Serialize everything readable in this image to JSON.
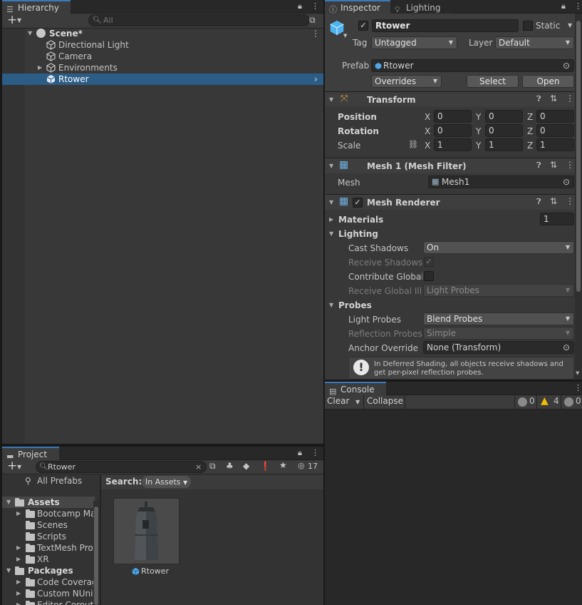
{
  "hierarchy": {
    "tab_label": "Hierarchy",
    "search_placeholder": "All",
    "add_label": "+",
    "scene_name": "Scene*",
    "items": [
      {
        "label": "Directional Light"
      },
      {
        "label": "Camera"
      },
      {
        "label": "Environments"
      },
      {
        "label": "Rtower"
      }
    ],
    "icons": {
      "tab": "list-icon",
      "lock": "lock-icon",
      "more": "kebab-icon",
      "gameobject": "cube-icon"
    }
  },
  "inspector": {
    "tab_label": "Inspector",
    "lighting_tab_label": "Lighting",
    "object_name": "Rtower",
    "static_label": "Static",
    "tag_label": "Tag",
    "tag_value": "Untagged",
    "layer_label": "Layer",
    "layer_value": "Default",
    "prefab_label": "Prefab",
    "prefab_value": "Rtower",
    "overrides_label": "Overrides",
    "select_label": "Select",
    "open_label": "Open",
    "transform": {
      "title": "Transform",
      "position_label": "Position",
      "rotation_label": "Rotation",
      "scale_label": "Scale",
      "position": {
        "x": "0",
        "y": "0",
        "z": "0"
      },
      "rotation": {
        "x": "0",
        "y": "0",
        "z": "0"
      },
      "scale": {
        "x": "1",
        "y": "1",
        "z": "1"
      },
      "axis": {
        "x": "X",
        "y": "Y",
        "z": "Z"
      }
    },
    "mesh_filter": {
      "title": "Mesh 1 (Mesh Filter)",
      "mesh_label": "Mesh",
      "mesh_value": "Mesh1"
    },
    "mesh_renderer": {
      "title": "Mesh Renderer",
      "materials_label": "Materials",
      "materials_count": "1",
      "lighting_label": "Lighting",
      "cast_shadows_label": "Cast Shadows",
      "cast_shadows_value": "On",
      "receive_shadows_label": "Receive Shadows",
      "contribute_gi_label": "Contribute Global I",
      "receive_gi_label": "Receive Global Illu",
      "receive_gi_value": "Light Probes",
      "probes_label": "Probes",
      "light_probes_label": "Light Probes",
      "light_probes_value": "Blend Probes",
      "reflection_probes_label": "Reflection Probes",
      "reflection_probes_value": "Simple",
      "anchor_override_label": "Anchor Override",
      "anchor_override_value": "None (Transform)",
      "info_text": "In Deferred Shading, all objects receive shadows and get per-pixel reflection probes."
    }
  },
  "console": {
    "tab_label": "Console",
    "clear_label": "Clear",
    "collapse_label": "Collapse",
    "log_count": "0",
    "warning_count": "4",
    "error_count": "0"
  },
  "project": {
    "tab_label": "Project",
    "search_value": "Rtower",
    "hidden_count": "17",
    "all_prefabs_label": "All Prefabs",
    "search_label": "Search:",
    "search_scope": "In Assets",
    "tree": [
      {
        "label": "Assets",
        "level": 0,
        "bold": true,
        "expanded": true
      },
      {
        "label": "Bootcamp Ma",
        "level": 1,
        "arrow": true
      },
      {
        "label": "Scenes",
        "level": 1,
        "arrow": false
      },
      {
        "label": "Scripts",
        "level": 1,
        "arrow": false
      },
      {
        "label": "TextMesh Pro",
        "level": 1,
        "arrow": true
      },
      {
        "label": "XR",
        "level": 1,
        "arrow": true
      },
      {
        "label": "Packages",
        "level": 0,
        "bold": true,
        "expanded": true
      },
      {
        "label": "Code Coverag",
        "level": 1,
        "arrow": true
      },
      {
        "label": "Custom NUnit",
        "level": 1,
        "arrow": true
      },
      {
        "label": "Editor Coroutin",
        "level": 1,
        "arrow": true
      }
    ],
    "asset_name": "Rtower"
  },
  "colors": {
    "accent": "#3a79bb",
    "selection": "#2c5d87",
    "warning": "#f4bc02",
    "panel": "#383838"
  }
}
